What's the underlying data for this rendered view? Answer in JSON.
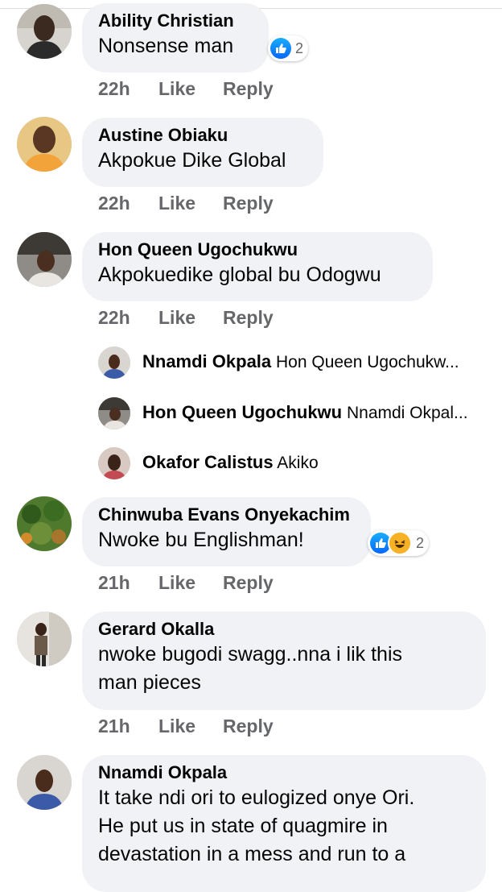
{
  "comments": [
    {
      "name": "Ability Christian",
      "text": "Nonsense man",
      "time": "22h",
      "like": "Like",
      "reply": "Reply",
      "reaction_count": "2",
      "reactions": [
        "like-icon"
      ]
    },
    {
      "name": "Austine Obiaku",
      "text": "Akpokue Dike Global",
      "time": "22h",
      "like": "Like",
      "reply": "Reply"
    },
    {
      "name": "Hon Queen Ugochukwu",
      "text": "Akpokuedike global bu Odogwu",
      "time": "22h",
      "like": "Like",
      "reply": "Reply"
    },
    {
      "name": "Chinwuba Evans Onyekachim",
      "text": "Nwoke bu Englishman!",
      "time": "21h",
      "like": "Like",
      "reply": "Reply",
      "reaction_count": "2",
      "reactions": [
        "like-icon",
        "haha-icon"
      ]
    },
    {
      "name": "Gerard Okalla",
      "text_line1": "nwoke bugodi swagg..nna i lik this",
      "text_line2": "man pieces",
      "time": "21h",
      "like": "Like",
      "reply": "Reply"
    },
    {
      "name": "Nnamdi Okpala",
      "text_line1": "It take ndi ori to eulogized onye Ori.",
      "text_line2": "He put us in state of quagmire in",
      "text_line3": "devastation in a mess and run to a"
    }
  ],
  "replies": [
    {
      "name": "Nnamdi Okpala",
      "preview": "Hon Queen Ugochukw..."
    },
    {
      "name": "Hon Queen Ugochukwu",
      "preview": "Nnamdi Okpal..."
    },
    {
      "name": "Okafor Calistus",
      "preview": "Akiko"
    }
  ]
}
